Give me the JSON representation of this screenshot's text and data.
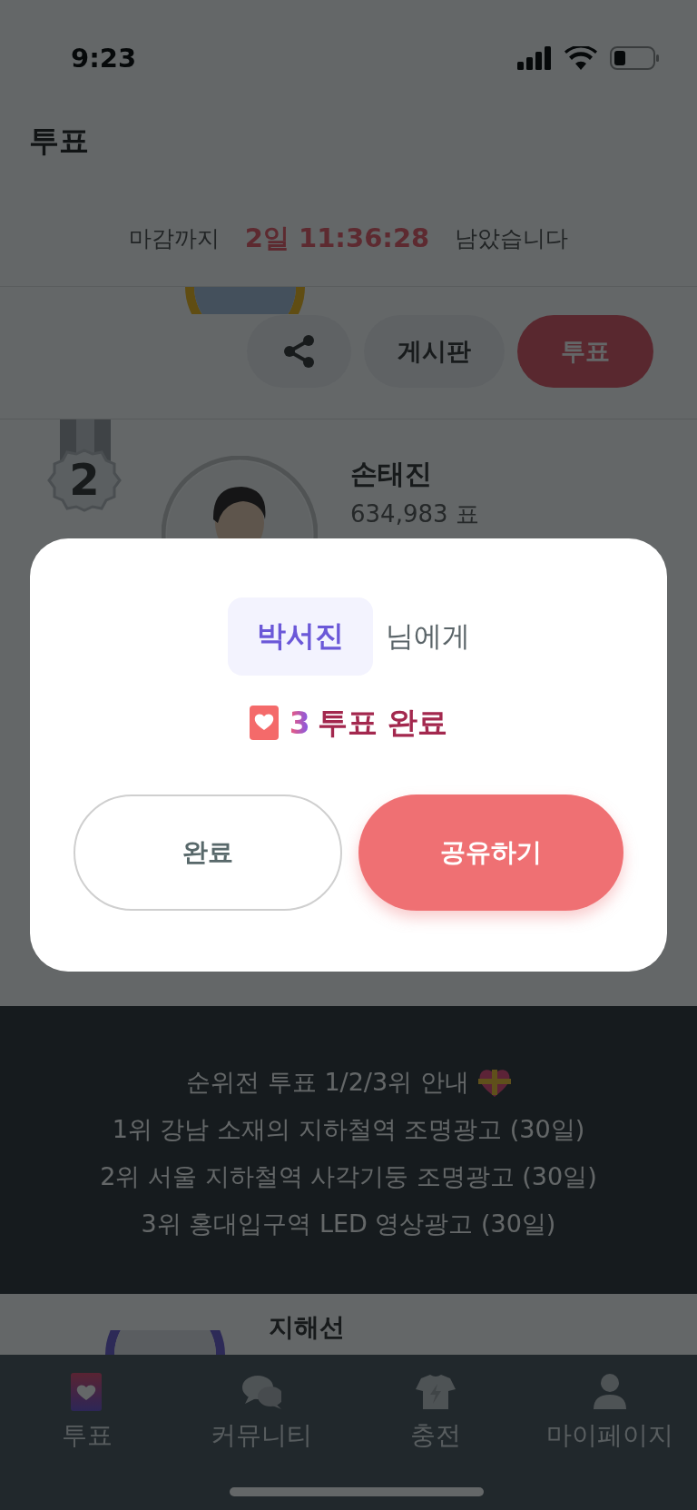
{
  "status_bar": {
    "time": "9:23"
  },
  "header": {
    "title": "투표"
  },
  "countdown": {
    "prefix": "마감까지",
    "time": "2일 11:36:28",
    "suffix": "남았습니다"
  },
  "first_entry": {
    "actions": [
      {
        "kind": "share"
      },
      {
        "kind": "board",
        "label": "게시판"
      },
      {
        "kind": "vote",
        "label": "투표"
      }
    ]
  },
  "ranking": [
    {
      "rank": "2",
      "name": "손태진",
      "votes": "634,983 표"
    }
  ],
  "banner": {
    "lines": [
      "순위전 투표 1/2/3위 안내",
      "1위 강남 소재의 지하철역 조명광고 (30일)",
      "2위 서울 지하철역 사각기둥 조명광고 (30일)",
      "3위 홍대입구역 LED 영상광고 (30일)"
    ]
  },
  "next_entry": {
    "name": "지해선"
  },
  "tab_bar": [
    {
      "kind": "vote",
      "label": "투표",
      "selected": true
    },
    {
      "kind": "community",
      "label": "커뮤니티",
      "selected": false
    },
    {
      "kind": "charge",
      "label": "충전",
      "selected": false
    },
    {
      "kind": "mypage",
      "label": "마이페이지",
      "selected": false
    }
  ],
  "dialog": {
    "recipient": "박서진",
    "recipient_suffix": "님에게",
    "count": "3",
    "message": "투표 완료",
    "buttons": [
      {
        "kind": "secondary",
        "label": "완료"
      },
      {
        "kind": "primary",
        "label": "공유하기"
      }
    ]
  }
}
